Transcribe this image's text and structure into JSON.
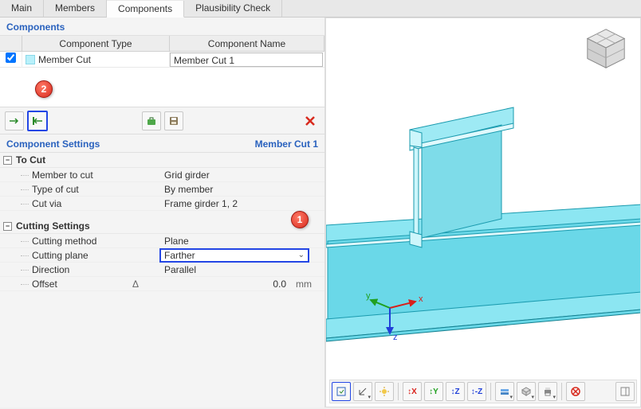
{
  "tabs": [
    "Main",
    "Members",
    "Components",
    "Plausibility Check"
  ],
  "active_tab_idx": 2,
  "components": {
    "title": "Components",
    "headers": {
      "type": "Component Type",
      "name": "Component Name"
    },
    "rows": [
      {
        "checked": true,
        "type": "Member Cut",
        "name": "Member Cut 1"
      }
    ]
  },
  "callouts": {
    "one": "1",
    "two": "2"
  },
  "settings": {
    "title": "Component Settings",
    "context": "Member Cut 1",
    "groups": [
      {
        "name": "To Cut",
        "rows": [
          {
            "label": "Member to cut",
            "value": "Grid girder"
          },
          {
            "label": "Type of cut",
            "value": "By member"
          },
          {
            "label": "Cut via",
            "value": "Frame girder 1, 2"
          }
        ]
      },
      {
        "name": "Cutting Settings",
        "rows": [
          {
            "label": "Cutting method",
            "value": "Plane"
          },
          {
            "label": "Cutting plane",
            "value": "Farther",
            "combo": true
          },
          {
            "label": "Direction",
            "value": "Parallel"
          },
          {
            "label": "Offset",
            "delta": "Δ",
            "value": "0.0",
            "unit": "mm",
            "numeric": true
          }
        ]
      }
    ]
  },
  "axes": {
    "x": "x",
    "y": "y",
    "z": "z"
  },
  "colors": {
    "beam_fill": "#8ce6f2",
    "beam_edge": "#1a9aae",
    "highlight": "#2346e5",
    "badge": "#d82a1e",
    "link": "#2a62be"
  }
}
